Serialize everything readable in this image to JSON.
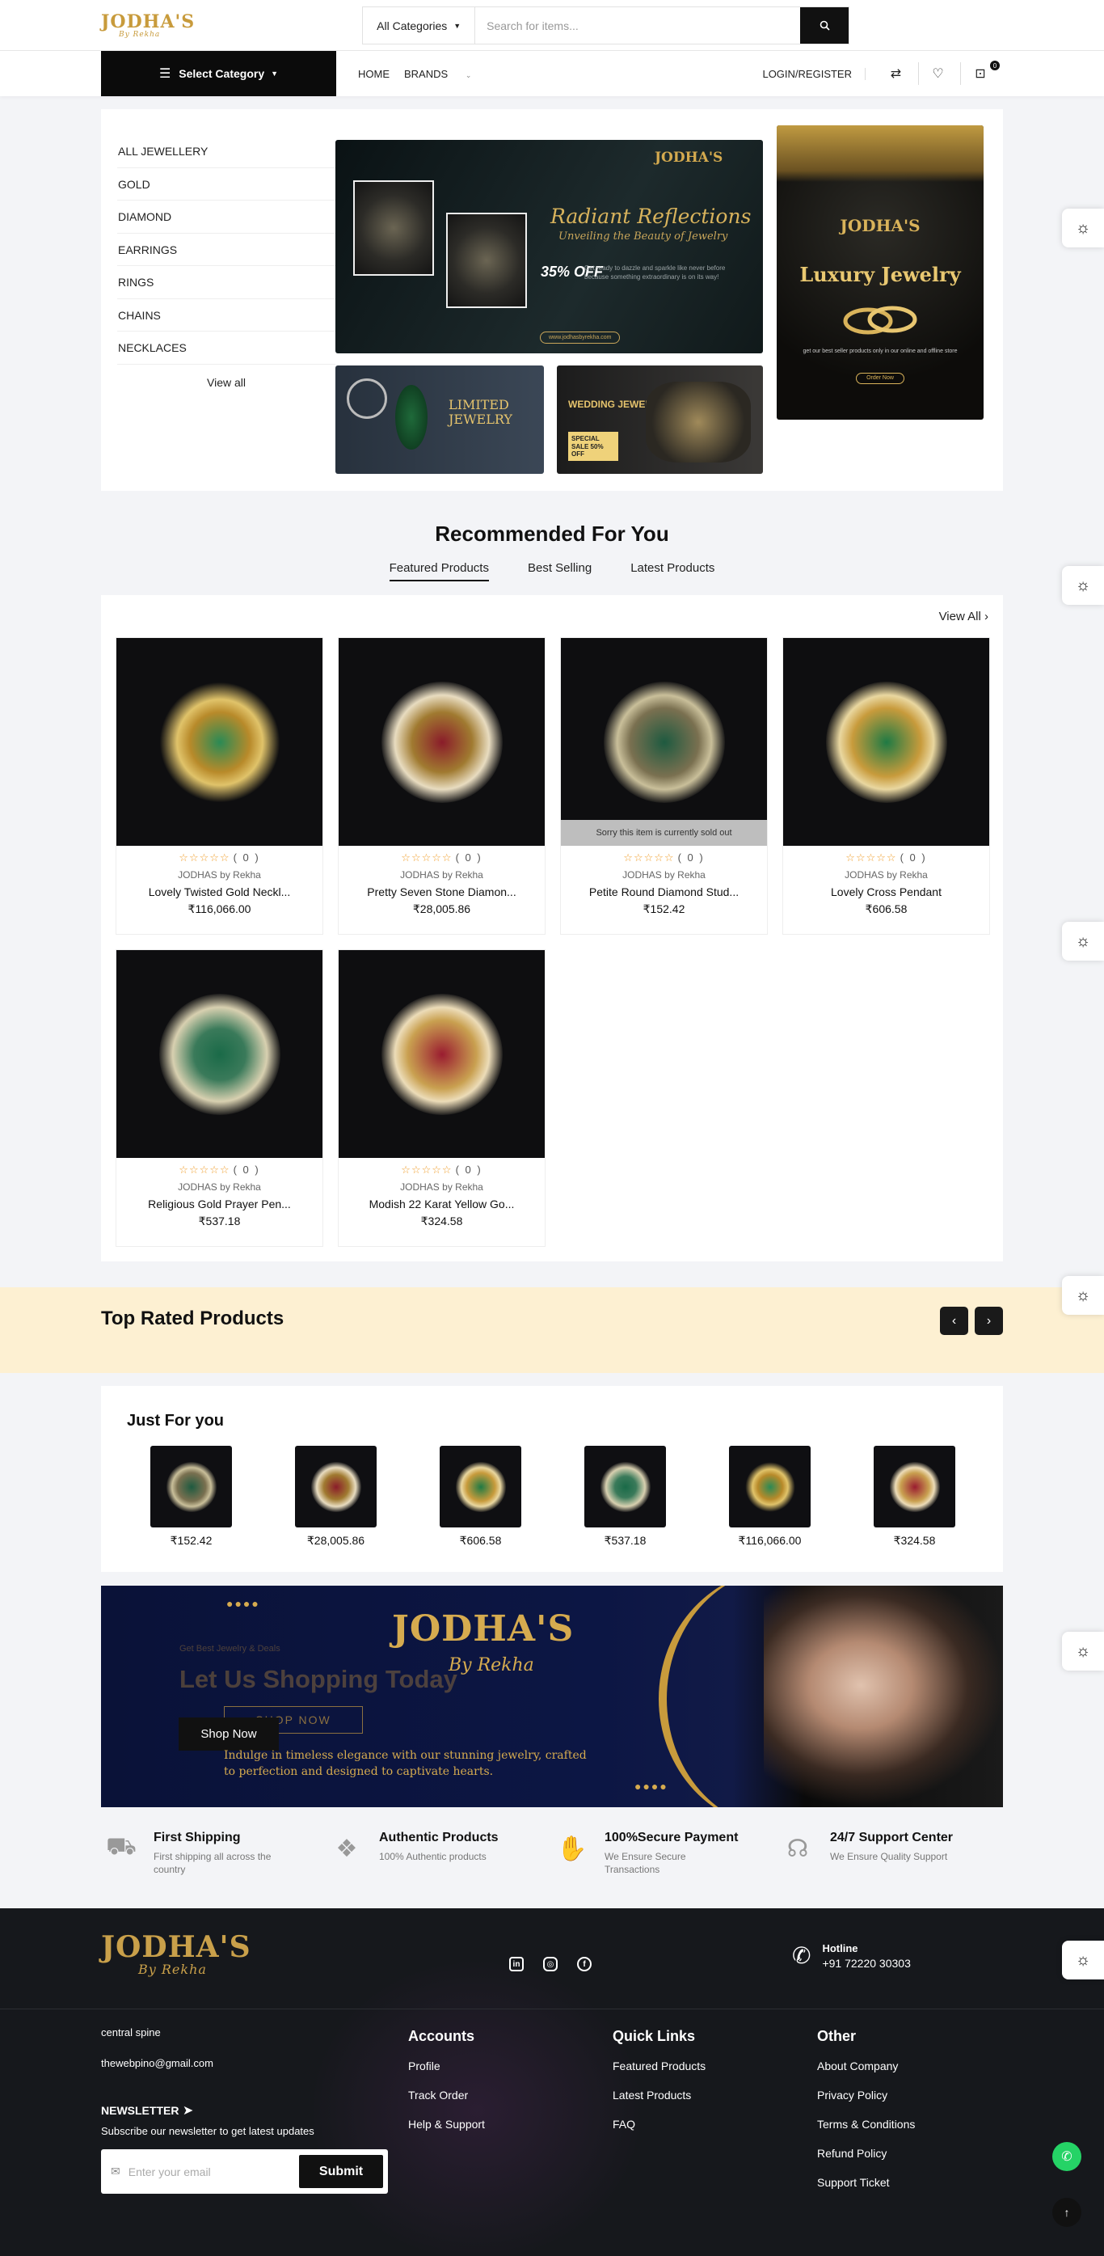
{
  "header": {
    "logo": "JODHA'S",
    "logo_sub": "By Rekha",
    "search_category": "All Categories",
    "search_placeholder": "Search for items..."
  },
  "nav": {
    "select_category": "Select Category",
    "links": [
      "HOME",
      "BRANDS"
    ],
    "login": "LOGIN/REGISTER",
    "cart_count": "0"
  },
  "categories": [
    "ALL JEWELLERY",
    "GOLD",
    "DIAMOND",
    "EARRINGS",
    "RINGS",
    "CHAINS",
    "NECKLACES"
  ],
  "categories_view_all": "View all",
  "banners": {
    "main_logo": "JODHA'S",
    "main_title": "Radiant Reflections",
    "main_subtitle": "Unveiling the Beauty of Jewelry",
    "main_offer": "35% OFF",
    "main_text": "Get ready to dazzle and sparkle like never before because something extraordinary is on its way!",
    "main_url": "www.jodhasbyrekha.com",
    "limited": "LIMITED JEWELRY",
    "wedding": "WEDDING JEWELRY",
    "wedding_offer": "SPECIAL SALE 50% OFF",
    "luxury_logo": "JODHA'S",
    "luxury_title": "Luxury Jewelry",
    "luxury_text": "get our best seller products only in our online and offline store",
    "luxury_btn": "Order Now"
  },
  "recommended": {
    "title": "Recommended For You",
    "tabs": [
      "Featured Products",
      "Best Selling",
      "Latest Products"
    ],
    "view_all": "View All",
    "stars": "☆☆☆☆☆",
    "products": [
      {
        "rating": "( 0 )",
        "brand": "JODHAS by Rekha",
        "name": "Lovely Twisted Gold Neckl...",
        "price": "₹116,066.00",
        "sold_out": ""
      },
      {
        "rating": "( 0 )",
        "brand": "JODHAS by Rekha",
        "name": "Pretty Seven Stone Diamon...",
        "price": "₹28,005.86",
        "sold_out": ""
      },
      {
        "rating": "( 0 )",
        "brand": "JODHAS by Rekha",
        "name": "Petite Round Diamond Stud...",
        "price": "₹152.42",
        "sold_out": "Sorry this item is currently sold out"
      },
      {
        "rating": "( 0 )",
        "brand": "JODHAS by Rekha",
        "name": "Lovely Cross Pendant",
        "price": "₹606.58",
        "sold_out": ""
      },
      {
        "rating": "( 0 )",
        "brand": "JODHAS by Rekha",
        "name": "Religious Gold Prayer Pen...",
        "price": "₹537.18",
        "sold_out": ""
      },
      {
        "rating": "( 0 )",
        "brand": "JODHAS by Rekha",
        "name": "Modish 22 Karat Yellow Go...",
        "price": "₹324.58",
        "sold_out": ""
      }
    ]
  },
  "top_rated": {
    "title": "Top Rated Products"
  },
  "just_for_you": {
    "title": "Just For you",
    "prices": [
      "₹152.42",
      "₹28,005.86",
      "₹606.58",
      "₹537.18",
      "₹116,066.00",
      "₹324.58"
    ]
  },
  "promo": {
    "logo": "JODHA'S",
    "logo_sub": "By Rekha",
    "ghost_small": "Get Best Jewelry & Deals",
    "ghost_title": "Let Us Shopping Today",
    "shop_now": "Shop Now",
    "ghost_button": "SHOP NOW",
    "desc": "Indulge in timeless elegance with our stunning jewelry, crafted to perfection and designed to captivate hearts."
  },
  "features": [
    {
      "title": "First Shipping",
      "text": "First shipping all across the country"
    },
    {
      "title": "Authentic Products",
      "text": "100% Authentic products"
    },
    {
      "title": "100%Secure Payment",
      "text": "We Ensure Secure Transactions"
    },
    {
      "title": "24/7 Support Center",
      "text": "We Ensure Quality Support"
    }
  ],
  "footer": {
    "logo": "JODHA'S",
    "logo_sub": "By Rekha",
    "hotline_label": "Hotline",
    "hotline": "+91 72220 30303",
    "address": "central spine",
    "email": "thewebpino@gmail.com",
    "newsletter_title": "NEWSLETTER",
    "newsletter_sub": "Subscribe our newsletter to get latest updates",
    "email_placeholder": "Enter your email",
    "submit": "Submit",
    "accounts": {
      "title": "Accounts",
      "links": [
        "Profile",
        "Track Order",
        "Help & Support"
      ]
    },
    "quick": {
      "title": "Quick Links",
      "links": [
        "Featured Products",
        "Latest Products",
        "FAQ"
      ]
    },
    "other": {
      "title": "Other",
      "links": [
        "About Company",
        "Privacy Policy",
        "Terms & Conditions",
        "Refund Policy",
        "Support Ticket"
      ]
    }
  }
}
